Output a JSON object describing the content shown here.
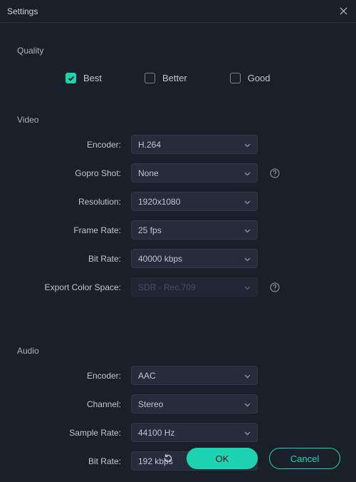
{
  "window": {
    "title": "Settings"
  },
  "quality": {
    "section_label": "Quality",
    "options": {
      "best": {
        "label": "Best",
        "checked": true
      },
      "better": {
        "label": "Better",
        "checked": false
      },
      "good": {
        "label": "Good",
        "checked": false
      }
    }
  },
  "video": {
    "section_label": "Video",
    "encoder": {
      "label": "Encoder:",
      "value": "H.264"
    },
    "gopro_shot": {
      "label": "Gopro Shot:",
      "value": "None"
    },
    "resolution": {
      "label": "Resolution:",
      "value": "1920x1080"
    },
    "frame_rate": {
      "label": "Frame Rate:",
      "value": "25 fps"
    },
    "bit_rate": {
      "label": "Bit Rate:",
      "value": "40000 kbps"
    },
    "export_color_space": {
      "label": "Export Color Space:",
      "value": "SDR - Rec.709"
    }
  },
  "audio": {
    "section_label": "Audio",
    "encoder": {
      "label": "Encoder:",
      "value": "AAC"
    },
    "channel": {
      "label": "Channel:",
      "value": "Stereo"
    },
    "sample_rate": {
      "label": "Sample Rate:",
      "value": "44100 Hz"
    },
    "bit_rate": {
      "label": "Bit Rate:",
      "value": "192 kbps"
    }
  },
  "footer": {
    "ok": "OK",
    "cancel": "Cancel"
  },
  "colors": {
    "accent": "#1cd4b0",
    "bg": "#1a2029",
    "select_bg": "#252d3a"
  }
}
